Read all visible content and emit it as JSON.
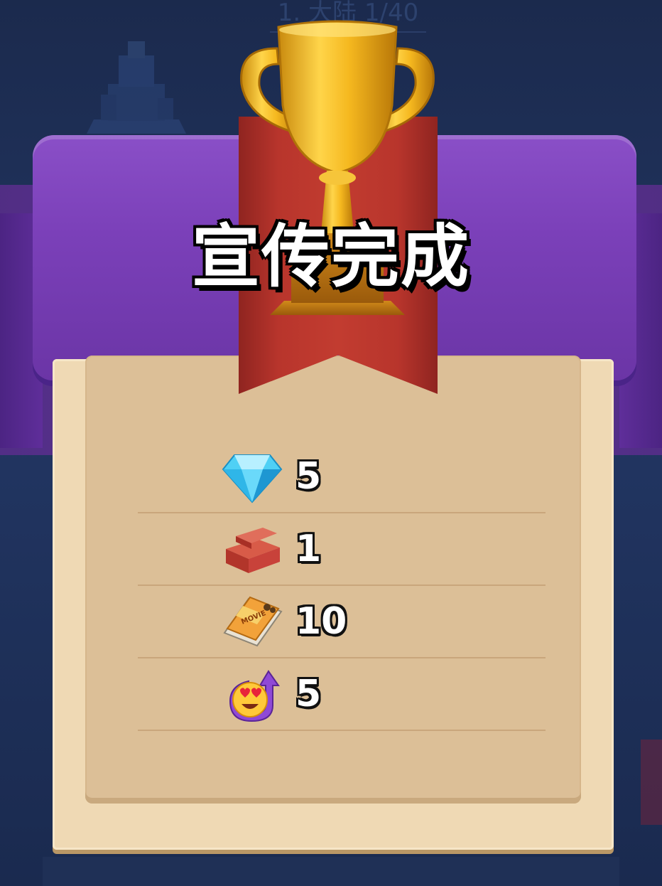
{
  "background": {
    "stage_label": "1. 大陆 1/40"
  },
  "title": "宣传完成",
  "rewards": [
    {
      "icon": "diamond-icon",
      "value": "5"
    },
    {
      "icon": "brick-icon",
      "value": "1"
    },
    {
      "icon": "movie-magazine-icon",
      "value": "10"
    },
    {
      "icon": "heart-eyes-fan-up-icon",
      "value": "5"
    }
  ],
  "colors": {
    "banner_purple": "#7b40b9",
    "ribbon_red": "#c23c30",
    "trophy_gold": "#f2b51e",
    "panel_parchment": "#dcbf97"
  }
}
